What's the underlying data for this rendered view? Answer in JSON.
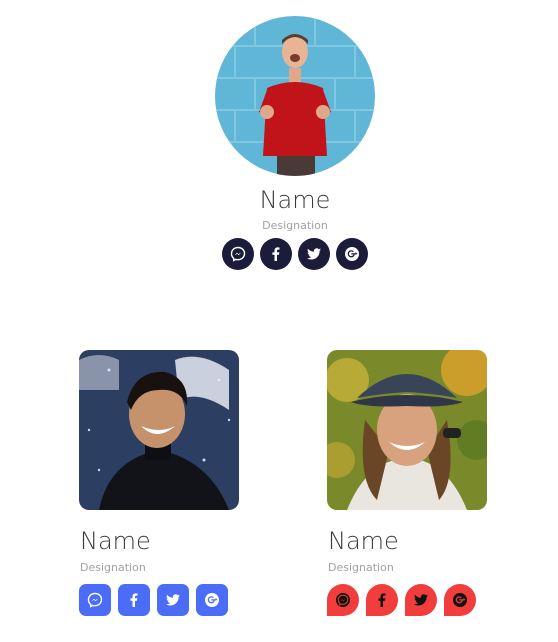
{
  "team": [
    {
      "name": "Name",
      "designation": "Designation",
      "colors": {
        "icon_bg": "#1b1b3a"
      },
      "socials": [
        "messenger-icon",
        "facebook-icon",
        "twitter-icon",
        "google-plus-icon"
      ]
    },
    {
      "name": "Name",
      "designation": "Designation",
      "colors": {
        "icon_bg": "#4a6cf7"
      },
      "socials": [
        "messenger-icon",
        "facebook-icon",
        "twitter-icon",
        "google-plus-icon"
      ]
    },
    {
      "name": "Name",
      "designation": "Designation",
      "colors": {
        "icon_bg": "#f23d3d"
      },
      "socials": [
        "messenger-icon",
        "facebook-icon",
        "twitter-icon",
        "google-plus-icon"
      ]
    }
  ]
}
